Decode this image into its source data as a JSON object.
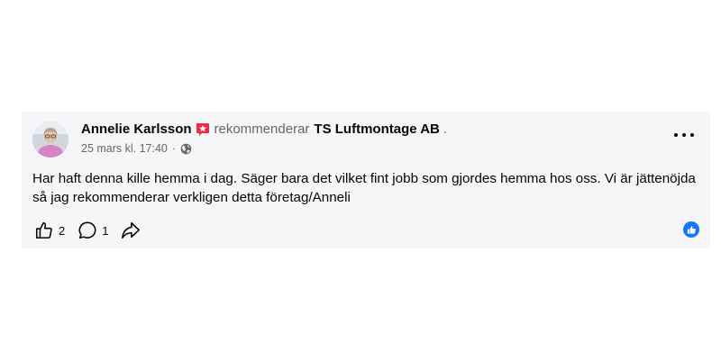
{
  "post": {
    "author": "Annelie Karlsson",
    "verb": "rekommenderar",
    "page": "TS Luftmontage AB",
    "after_page": ".",
    "date": "25 mars kl. 17:40",
    "separator": "·",
    "text": "Har haft denna kille hemma i dag. Säger bara det vilket fint jobb som gjordes hemma hos oss. Vi är jättenöjda så jag rekommenderar verkligen detta företag/Anneli",
    "likes": "2",
    "comments": "1",
    "icons": {
      "recommend": "recommend-badge-icon",
      "privacy": "globe-icon",
      "more": "more-options-icon",
      "like": "thumbs-up-icon",
      "comment": "comment-bubble-icon",
      "share": "share-arrow-icon",
      "reaction": "like-reaction-icon"
    },
    "colors": {
      "card_bg": "#f5f6f8",
      "badge_red": "#f02849",
      "like_blue": "#1877f2",
      "text": "#050505",
      "secondary": "#65676b"
    }
  }
}
